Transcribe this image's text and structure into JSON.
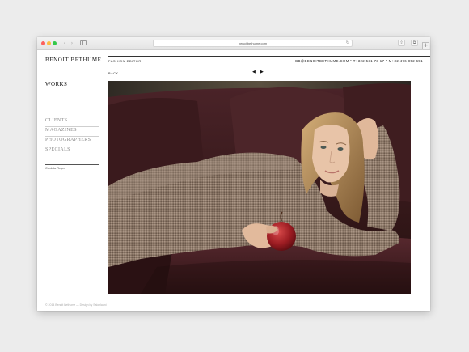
{
  "browser": {
    "url": "benoitbethume.com",
    "back_glyph": "‹",
    "forward_glyph": "›",
    "reload_glyph": "↻",
    "share_glyph": "⇧",
    "tabs_glyph": "⧉",
    "newtab_glyph": "+"
  },
  "site": {
    "brand": "BENOIT BETHUME",
    "role": "FASHION EDITOR",
    "contact": "BB@BENOITBETHUME.COM  *  T+322 531 73 17  *  M+32 476 852 651",
    "back_label": "BACK",
    "prev_arrow": "◀",
    "next_arrow": "▶",
    "nav": {
      "works": "WORKS",
      "categories": [
        "CLIENTS",
        "MAGAZINES",
        "PHOTOGRAPHERS",
        "SPECIALS"
      ]
    },
    "credit": "Cordula Reyer",
    "footer": "© 2014 Benoit Bethume   —   Design by Salonlauni"
  },
  "colors": {
    "sofa": "#3b1b1f",
    "sweater": "#8e7a6b",
    "hair": "#b58b56",
    "apple": "#9c1c22",
    "wall": "#4a4238"
  }
}
